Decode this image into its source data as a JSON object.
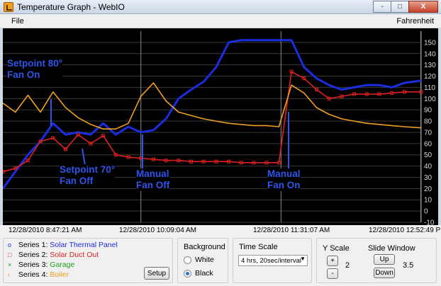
{
  "window": {
    "title": "Temperature Graph - WebIO",
    "buttons": [
      "-",
      "□",
      "X"
    ]
  },
  "menu": {
    "file": "File",
    "unit": "Fahrenheit"
  },
  "annotations": {
    "setpoint80": [
      "Setpoint 80°",
      "Fan On"
    ],
    "setpoint70": [
      "Setpoint 70°",
      "Fan Off"
    ],
    "manual_off": [
      "Manual",
      "Fan Off"
    ],
    "manual_on": [
      "Manual",
      "Fan On"
    ]
  },
  "time_labels": [
    "12/28/2010 8:47:21 AM",
    "12/28/2010 10:09:04 AM",
    "12/28/2010 11:31:07 AM",
    "12/28/2010 12:52:49 PM"
  ],
  "series_panel": {
    "items": [
      {
        "key": "Series 1:",
        "name": "Solar Thermal Panel",
        "color": "#1a2ee0",
        "marker": "o"
      },
      {
        "key": "Series 2:",
        "name": "Solar Duct Out",
        "color": "#e02020",
        "marker": "□"
      },
      {
        "key": "Series 3:",
        "name": "Garage",
        "color": "#1aa01a",
        "marker": "×"
      },
      {
        "key": "Series 4:",
        "name": "Boiler",
        "color": "#f0a020",
        "marker": "ı"
      }
    ],
    "setup_label": "Setup"
  },
  "background": {
    "label": "Background",
    "options": [
      "White",
      "Black"
    ],
    "selected": "Black"
  },
  "time_scale": {
    "label": "Time Scale",
    "value": "4 hrs, 20sec/interval"
  },
  "y_scale": {
    "label": "Y Scale",
    "plus": "+",
    "minus": "-",
    "value": "2"
  },
  "slide_window": {
    "label": "Slide Window",
    "up": "Up",
    "down": "Down",
    "value": "3.5"
  },
  "chart_data": {
    "type": "line",
    "ylim": [
      -10,
      160
    ],
    "y_ticks": [
      -10,
      0,
      10,
      20,
      30,
      40,
      50,
      60,
      70,
      80,
      90,
      100,
      110,
      120,
      130,
      140,
      150
    ],
    "x": [
      0,
      3,
      6,
      9,
      12,
      15,
      18,
      21,
      24,
      27,
      30,
      33,
      36,
      39,
      42,
      45,
      48,
      51,
      54,
      57,
      60,
      63,
      66,
      69,
      72,
      75,
      78,
      81,
      84,
      87,
      90,
      93,
      96,
      100
    ],
    "grid": true,
    "series": [
      {
        "name": "Solar Thermal Panel",
        "color": "#1a2ee0",
        "values": [
          20,
          35,
          50,
          62,
          78,
          68,
          70,
          68,
          78,
          68,
          75,
          70,
          72,
          82,
          100,
          108,
          115,
          128,
          150,
          152,
          152,
          152,
          152,
          152,
          128,
          118,
          112,
          108,
          110,
          112,
          112,
          110,
          114,
          116
        ]
      },
      {
        "name": "Solar Duct Out",
        "color": "#e02020",
        "values": [
          35,
          38,
          45,
          62,
          65,
          55,
          68,
          60,
          67,
          50,
          48,
          47,
          46,
          45,
          45,
          44,
          44,
          44,
          44,
          43,
          43,
          43,
          43,
          124,
          118,
          108,
          100,
          102,
          104,
          104,
          104,
          105,
          106,
          106
        ]
      },
      {
        "name": "Garage",
        "color": "#1aa01a",
        "values": []
      },
      {
        "name": "Boiler",
        "color": "#f0a020",
        "values": [
          96,
          88,
          103,
          88,
          106,
          92,
          83,
          77,
          73,
          73,
          78,
          102,
          114,
          98,
          88,
          85,
          82,
          80,
          78,
          77,
          76,
          76,
          75,
          112,
          105,
          92,
          86,
          82,
          80,
          78,
          77,
          76,
          75,
          74
        ]
      }
    ]
  }
}
